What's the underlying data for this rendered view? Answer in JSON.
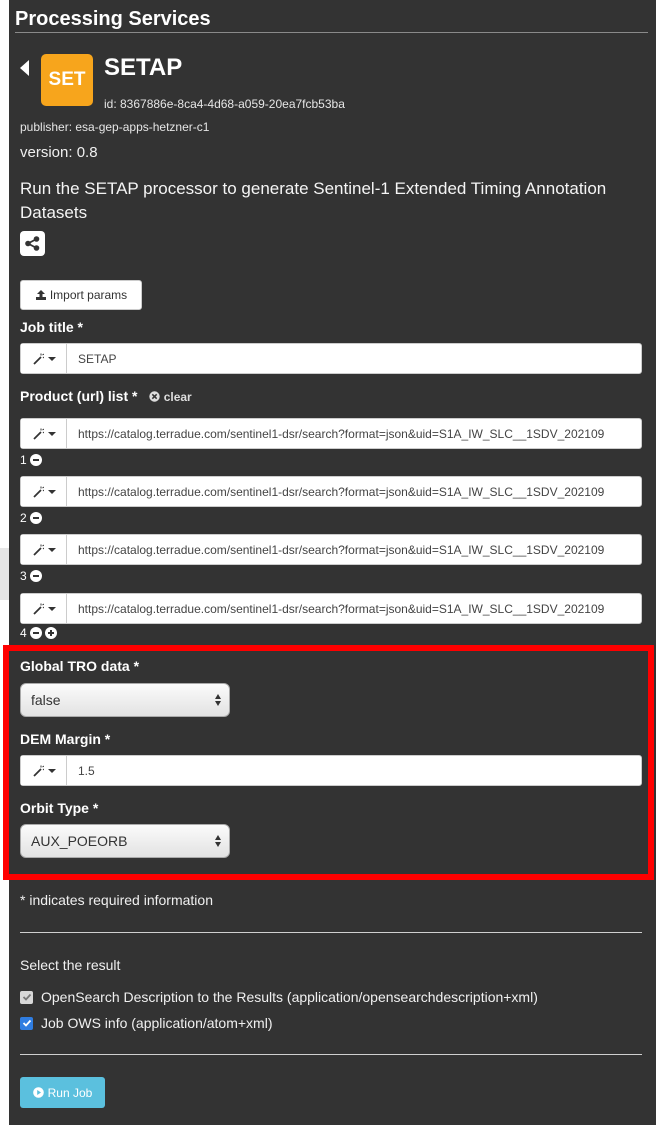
{
  "header": {
    "title": "Processing Services"
  },
  "app": {
    "logo_text": "SET",
    "logo_color": "#f7a51c",
    "name": "SETAP",
    "id": "id: 8367886e-8ca4-4d68-a059-20ea7fcb53ba",
    "publisher": "publisher: esa-gep-apps-hetzner-c1",
    "version": "version: 0.8",
    "description": "Run the SETAP processor to generate Sentinel-1 Extended Timing Annotation Datasets"
  },
  "toolbar": {
    "share_icon": "share-icon",
    "import_label": "Import params",
    "import_icon": "upload-icon"
  },
  "form": {
    "job_title": {
      "label": "Job title *",
      "value": "SETAP"
    },
    "product_list": {
      "label": "Product (url) list *",
      "clear_label": "clear",
      "items": [
        {
          "index": "1",
          "value": "https://catalog.terradue.com/sentinel1-dsr/search?format=json&uid=S1A_IW_SLC__1SDV_202109"
        },
        {
          "index": "2",
          "value": "https://catalog.terradue.com/sentinel1-dsr/search?format=json&uid=S1A_IW_SLC__1SDV_202109"
        },
        {
          "index": "3",
          "value": "https://catalog.terradue.com/sentinel1-dsr/search?format=json&uid=S1A_IW_SLC__1SDV_202109"
        },
        {
          "index": "4",
          "value": "https://catalog.terradue.com/sentinel1-dsr/search?format=json&uid=S1A_IW_SLC__1SDV_202109"
        }
      ]
    },
    "global_tro": {
      "label": "Global TRO data *",
      "value": "false"
    },
    "dem_margin": {
      "label": "DEM Margin *",
      "value": "1.5"
    },
    "orbit_type": {
      "label": "Orbit Type *",
      "value": "AUX_POEORB"
    },
    "required_note": "* indicates required information"
  },
  "results": {
    "title": "Select the result",
    "options": [
      {
        "label": "OpenSearch Description to the Results (application/opensearchdescription+xml)",
        "checked": true,
        "disabled": true
      },
      {
        "label": "Job OWS info (application/atom+xml)",
        "checked": true,
        "disabled": false
      }
    ]
  },
  "actions": {
    "run_label": "Run Job",
    "run_color": "#5bc0de"
  },
  "colors": {
    "panel_bg": "#333333",
    "highlight": "#ff0000"
  }
}
